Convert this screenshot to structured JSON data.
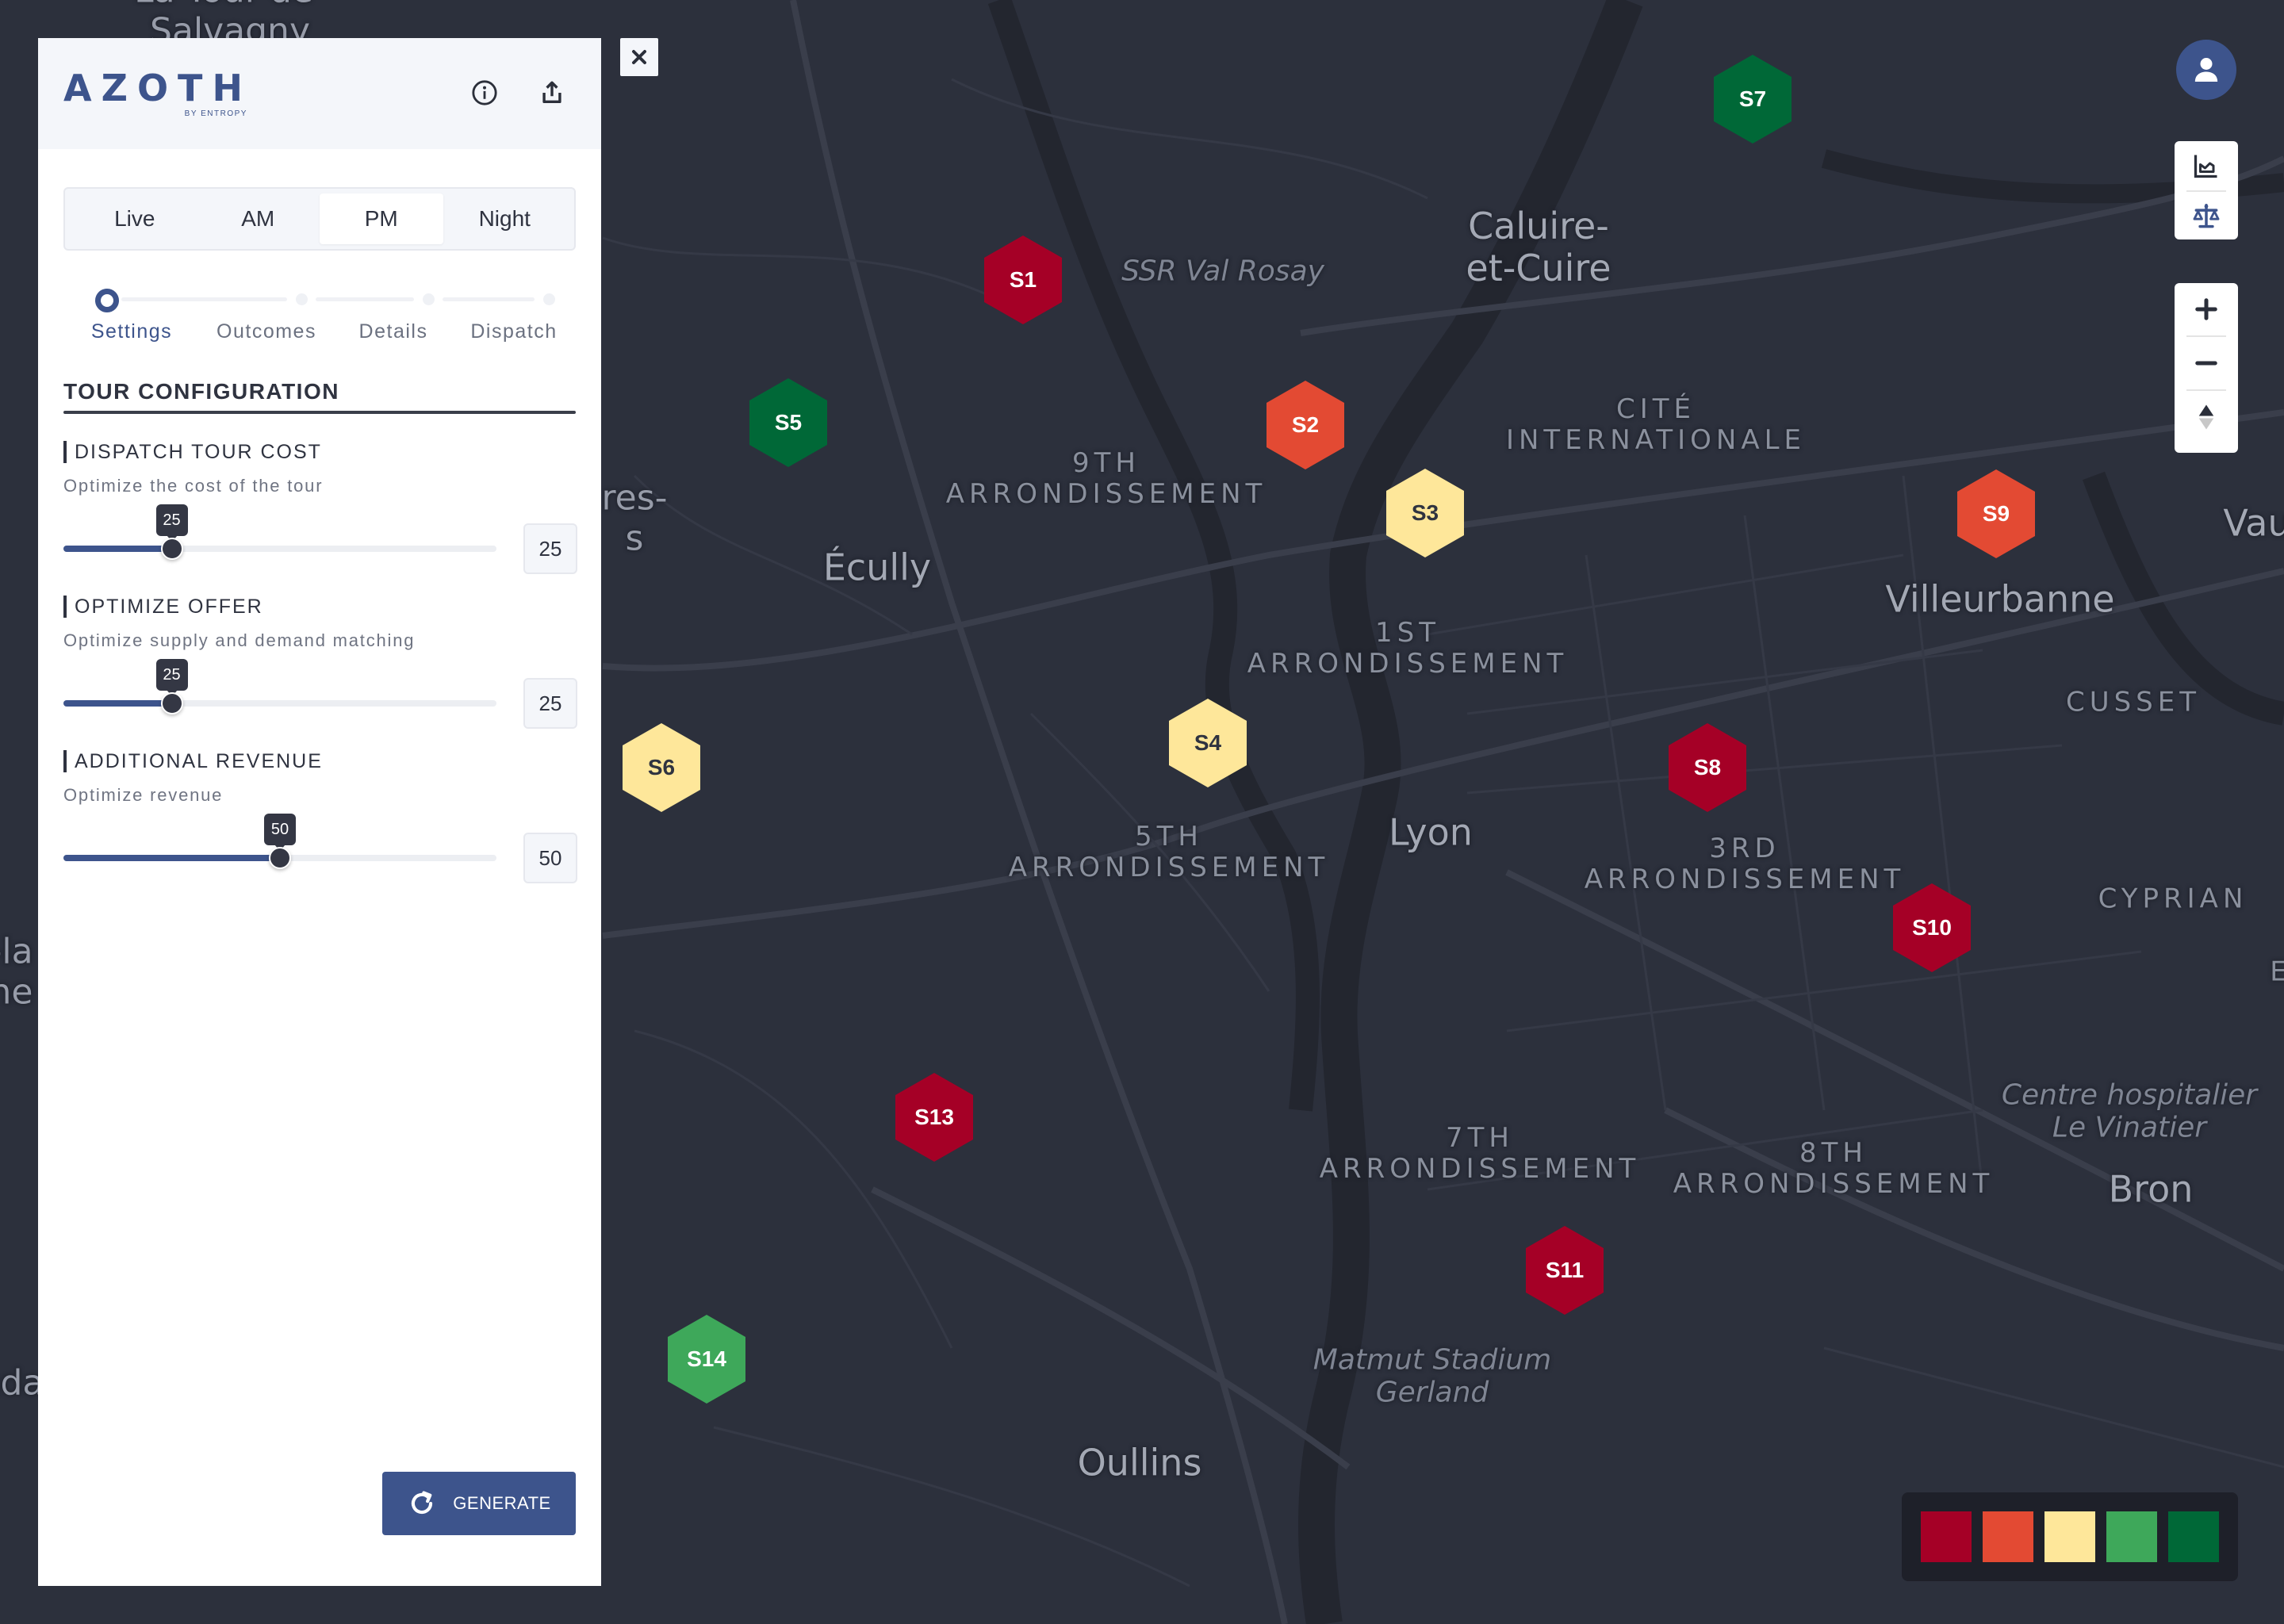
{
  "app": {
    "brand": "AZOTH",
    "brand_byline": "BY ENTROPY",
    "header_icons": [
      "info-icon",
      "share-export-icon"
    ]
  },
  "period_tabs": {
    "items": [
      {
        "label": "Live",
        "active": false
      },
      {
        "label": "AM",
        "active": false
      },
      {
        "label": "PM",
        "active": true
      },
      {
        "label": "Night",
        "active": false
      }
    ]
  },
  "stepper": {
    "steps": [
      {
        "label": "Settings",
        "active": true
      },
      {
        "label": "Outcomes",
        "active": false
      },
      {
        "label": "Details",
        "active": false
      },
      {
        "label": "Dispatch",
        "active": false
      }
    ]
  },
  "section": {
    "title": "TOUR CONFIGURATION",
    "params": [
      {
        "title": "DISPATCH TOUR COST",
        "description": "Optimize the cost of the tour",
        "value": 25,
        "min": 0,
        "max": 100
      },
      {
        "title": "OPTIMIZE OFFER",
        "description": "Optimize supply and demand matching",
        "value": 25,
        "min": 0,
        "max": 100
      },
      {
        "title": "ADDITIONAL REVENUE",
        "description": "Optimize revenue",
        "value": 50,
        "min": 0,
        "max": 100
      }
    ]
  },
  "actions": {
    "generate_label": "GENERATE",
    "close_icon": "close-icon"
  },
  "map_controls": {
    "avatar_icon": "user-icon",
    "tools": [
      "chart-icon",
      "balance-scale-icon"
    ],
    "zoom_in": "plus-icon",
    "zoom_out": "minus-icon",
    "compass": "compass-north-icon"
  },
  "legend": {
    "colors": [
      "#a50026",
      "#e34a33",
      "#fee79a",
      "#3ea85a",
      "#006837"
    ]
  },
  "map": {
    "labels": [
      {
        "text": "La Tour-de-\nSalvagny",
        "kind": "town"
      },
      {
        "text": "SSR Val Rosay",
        "kind": "poi"
      },
      {
        "text": "Caluire-\net-Cuire",
        "kind": "city"
      },
      {
        "text": "CITÉ\nINTERNATIONALE",
        "kind": "district"
      },
      {
        "text": "9TH\nARRONDISSEMENT",
        "kind": "district"
      },
      {
        "text": "Écully",
        "kind": "city"
      },
      {
        "text": "res-\ns",
        "kind": "town"
      },
      {
        "text": "Villeurbanne",
        "kind": "city"
      },
      {
        "text": "Vau",
        "kind": "city"
      },
      {
        "text": "1ST\nARRONDISSEMENT",
        "kind": "district"
      },
      {
        "text": "CUSSET",
        "kind": "district"
      },
      {
        "text": "Lyon",
        "kind": "city"
      },
      {
        "text": "5TH\nARRONDISSEMENT",
        "kind": "district"
      },
      {
        "text": "3RD\nARRONDISSEMENT",
        "kind": "district"
      },
      {
        "text": "CYPRIAN",
        "kind": "district"
      },
      {
        "text": "E",
        "kind": "district"
      },
      {
        "text": "-la\nne",
        "kind": "town"
      },
      {
        "text": "Centre hospitalier\nLe Vinatier",
        "kind": "poi"
      },
      {
        "text": "7TH\nARRONDISSEMENT",
        "kind": "district"
      },
      {
        "text": "8TH\nARRONDISSEMENT",
        "kind": "district"
      },
      {
        "text": "Bron",
        "kind": "city"
      },
      {
        "text": "Matmut Stadium\nGerland",
        "kind": "poi"
      },
      {
        "text": "Oullins",
        "kind": "city"
      },
      {
        "text": "nda",
        "kind": "town"
      }
    ],
    "markers": [
      {
        "id": "S1",
        "level": 0
      },
      {
        "id": "S2",
        "level": 1
      },
      {
        "id": "S3",
        "level": 2
      },
      {
        "id": "S4",
        "level": 2
      },
      {
        "id": "S5",
        "level": 4
      },
      {
        "id": "S6",
        "level": 2
      },
      {
        "id": "S7",
        "level": 4
      },
      {
        "id": "S8",
        "level": 0
      },
      {
        "id": "S9",
        "level": 1
      },
      {
        "id": "S10",
        "level": 0
      },
      {
        "id": "S11",
        "level": 0
      },
      {
        "id": "S13",
        "level": 0
      },
      {
        "id": "S14",
        "level": 3
      }
    ]
  }
}
